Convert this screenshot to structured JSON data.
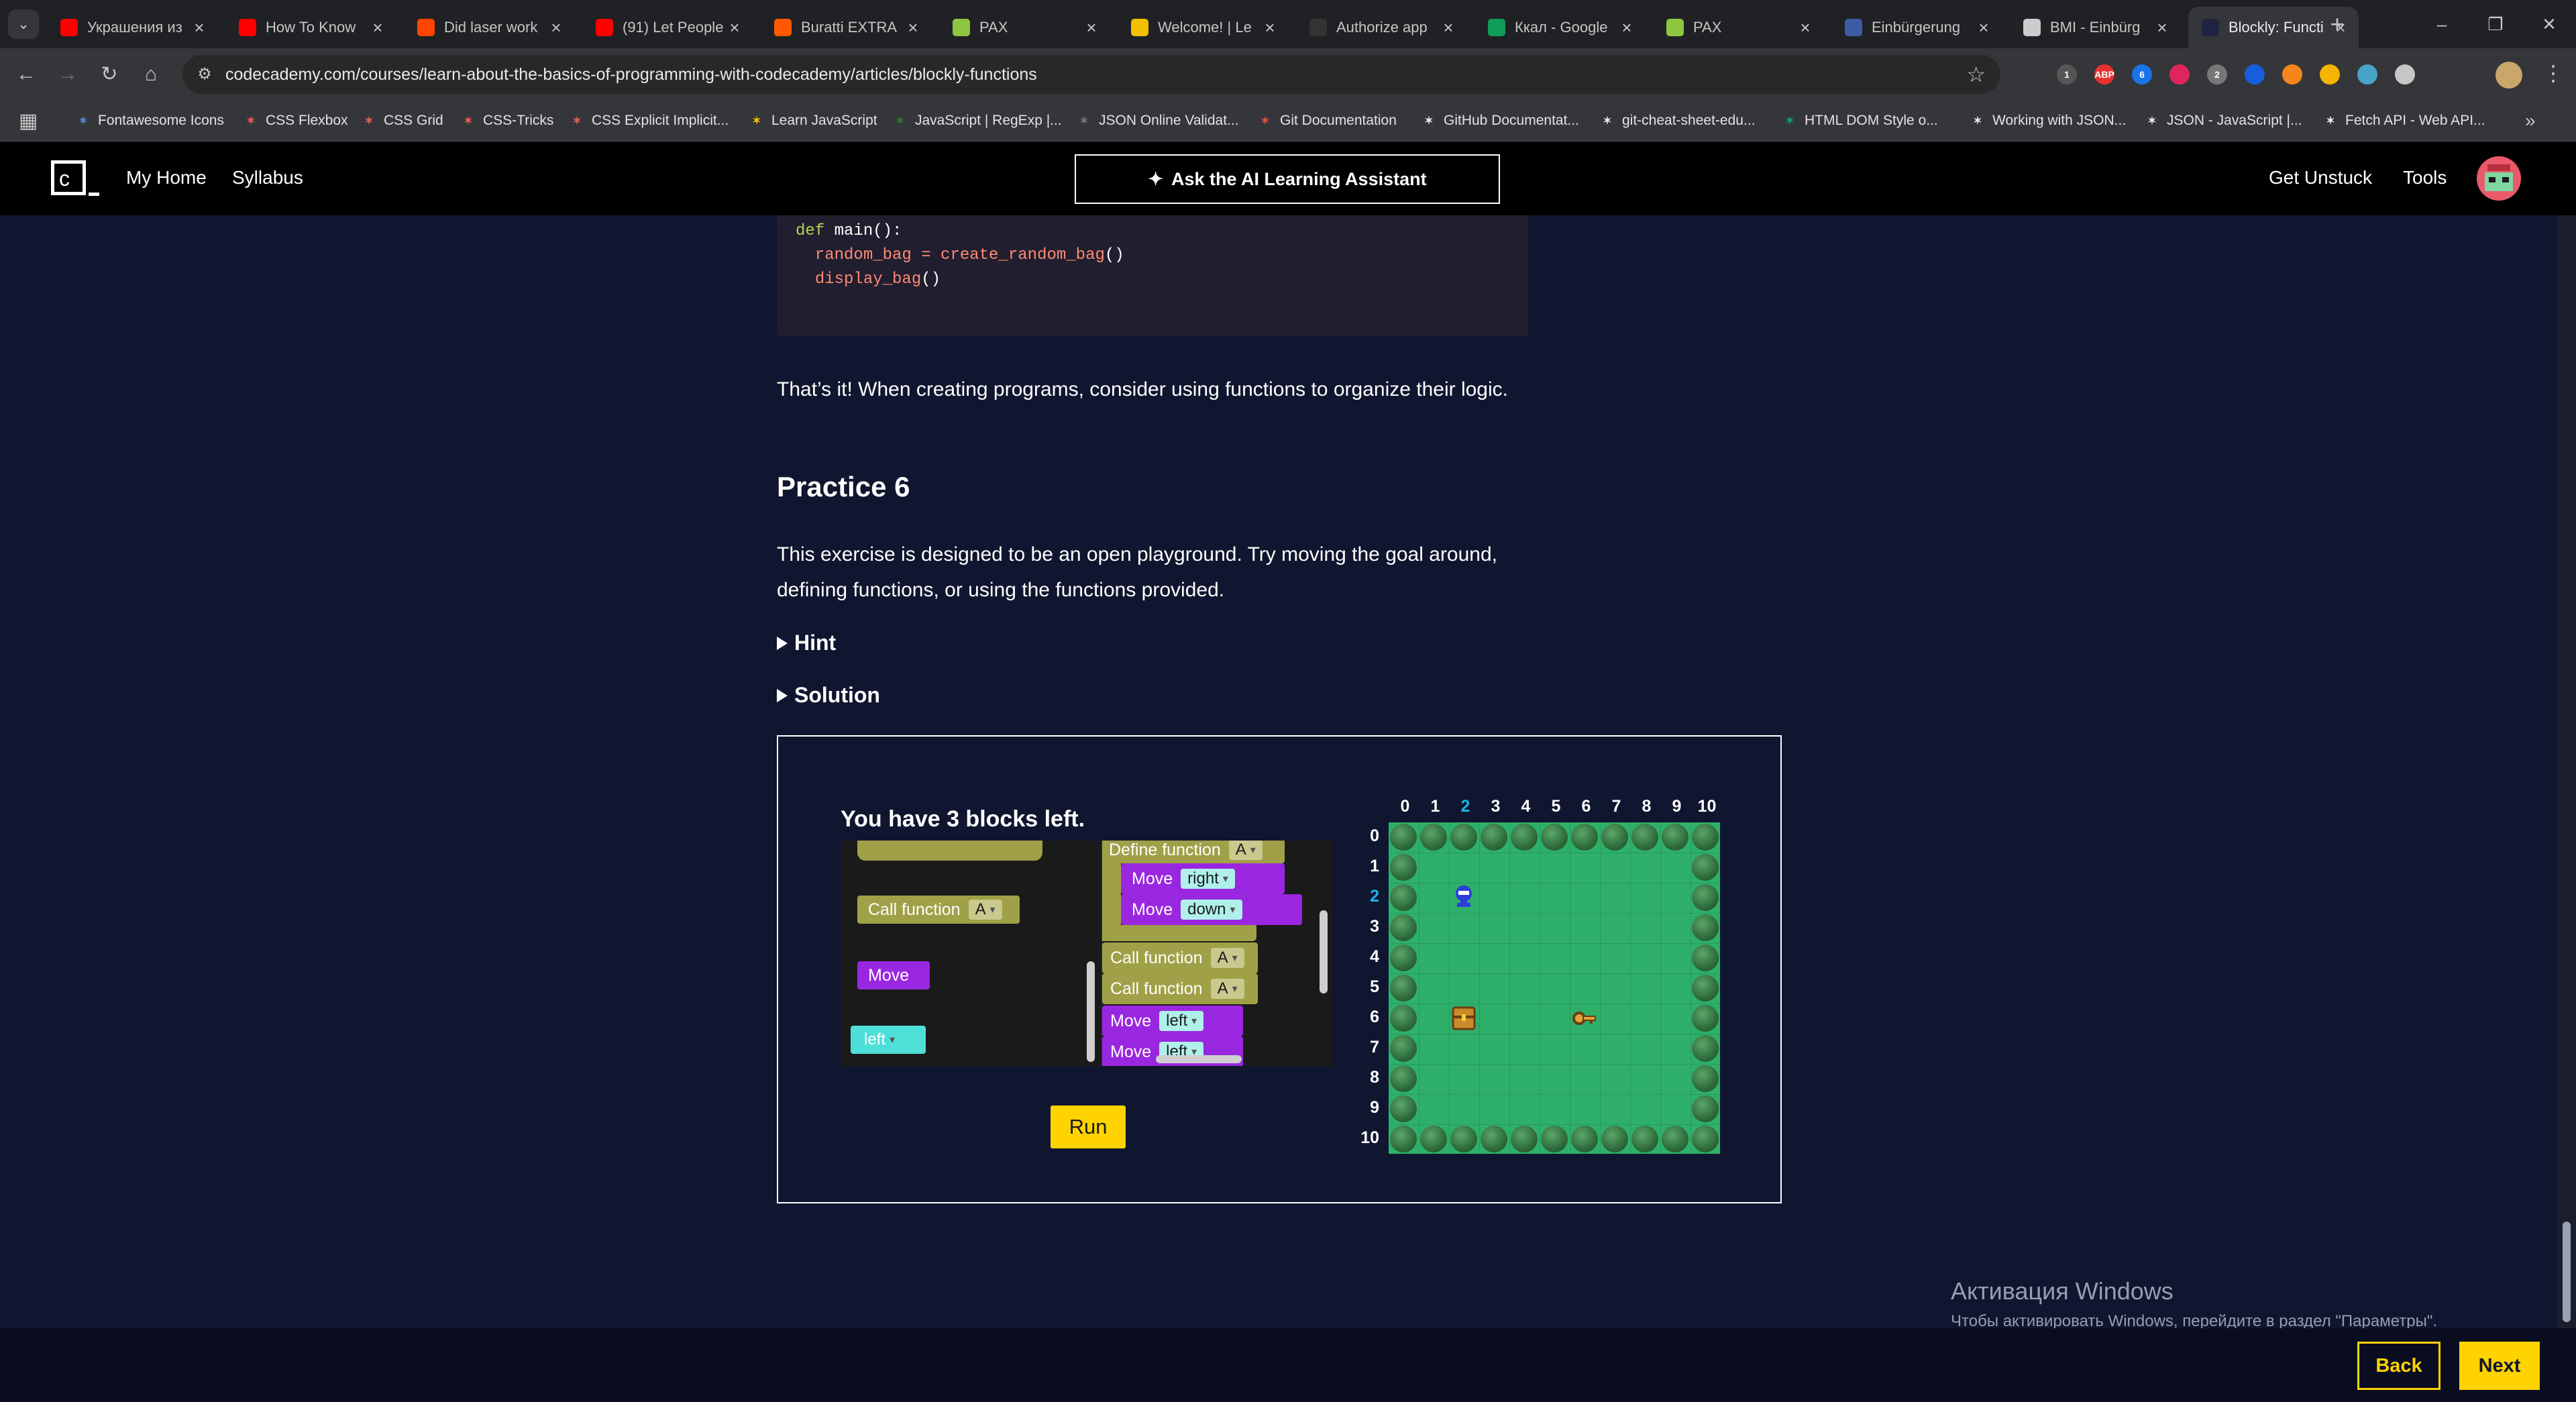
{
  "browser": {
    "tabs": [
      {
        "title": "Украшения из",
        "icon": "youtube-icon",
        "color": "#ff0000"
      },
      {
        "title": "How To Know",
        "icon": "youtube-icon",
        "color": "#ff0000"
      },
      {
        "title": "Did laser work",
        "icon": "reddit-icon",
        "color": "#ff4500"
      },
      {
        "title": "(91) Let People",
        "icon": "youtube-icon",
        "color": "#ff0000"
      },
      {
        "title": "Buratti EXTRA",
        "icon": "flame-icon",
        "color": "#ff5a00"
      },
      {
        "title": "PAX",
        "icon": "pax-icon",
        "color": "#8ec63f"
      },
      {
        "title": "Welcome! | Le",
        "icon": "js-icon",
        "color": "#f0c000"
      },
      {
        "title": "Authorize app",
        "icon": "github-icon",
        "color": "#333333"
      },
      {
        "title": "Ккал - Google",
        "icon": "sheets-icon",
        "color": "#0f9d58"
      },
      {
        "title": "PAX",
        "icon": "pax-icon",
        "color": "#8ec63f"
      },
      {
        "title": "Einbürgerung",
        "icon": "page-icon",
        "color": "#3b5ba5"
      },
      {
        "title": "BMI - Einbürg",
        "icon": "bmi-icon",
        "color": "#cccccc"
      },
      {
        "title": "Blockly: Functi",
        "icon": "codecademy-icon",
        "color": "#1f2540",
        "active": true
      }
    ],
    "url": "codecademy.com/courses/learn-about-the-basics-of-programming-with-codecademy/articles/blockly-functions",
    "extensions": [
      {
        "name": "extension-1-icon",
        "color": "#555555",
        "badge": "1"
      },
      {
        "name": "adblock-icon",
        "color": "#e83030",
        "label": "ABP"
      },
      {
        "name": "extension-6-icon",
        "color": "#1a73e8",
        "badge": "6"
      },
      {
        "name": "extension-pink-icon",
        "color": "#e0245e"
      },
      {
        "name": "extension-2-icon",
        "color": "#777777",
        "badge": "2"
      },
      {
        "name": "bitwarden-icon",
        "color": "#175ddc"
      },
      {
        "name": "metamask-icon",
        "color": "#f6851b"
      },
      {
        "name": "extension-yellow-icon",
        "color": "#f4b400"
      },
      {
        "name": "extension-cyan-icon",
        "color": "#4aa3c8"
      },
      {
        "name": "puzzle-icon",
        "color": "#c4c7c5"
      }
    ],
    "bookmarks": [
      {
        "label": "Fontawesome Icons",
        "icon": "flag-icon",
        "color": "#538dd7"
      },
      {
        "label": "CSS Flexbox",
        "icon": "css-tricks-icon",
        "color": "#e8634f"
      },
      {
        "label": "CSS Grid",
        "icon": "css-tricks-icon",
        "color": "#e8634f"
      },
      {
        "label": "CSS-Tricks",
        "icon": "css-tricks-icon",
        "color": "#e8634f"
      },
      {
        "label": "CSS Explicit Implicit...",
        "icon": "css-tricks-icon",
        "color": "#e8634f"
      },
      {
        "label": "Learn JavaScript",
        "icon": "js-icon",
        "color": "#f0c000"
      },
      {
        "label": "JavaScript | RegExp |...",
        "icon": "w3-icon",
        "color": "#2e7d32"
      },
      {
        "label": "JSON Online Validat...",
        "icon": "json-icon",
        "color": "#777777"
      },
      {
        "label": "Git Documentation",
        "icon": "git-icon",
        "color": "#f05032"
      },
      {
        "label": "GitHub Documentat...",
        "icon": "github-icon",
        "color": "#e8eaed"
      },
      {
        "label": "git-cheat-sheet-edu...",
        "icon": "github-icon",
        "color": "#e8eaed"
      },
      {
        "label": "HTML DOM Style o...",
        "icon": "w3-icon",
        "color": "#04aa6d"
      },
      {
        "label": "Working with JSON...",
        "icon": "mdn-icon",
        "color": "#e8eaed"
      },
      {
        "label": "JSON - JavaScript |...",
        "icon": "mdn-icon",
        "color": "#e8eaed"
      },
      {
        "label": "Fetch API - Web API...",
        "icon": "mdn-icon",
        "color": "#e8eaed"
      }
    ]
  },
  "header": {
    "nav": [
      "My Home",
      "Syllabus"
    ],
    "ai_button": "Ask the AI Learning Assistant",
    "right_nav": [
      "Get Unstuck",
      "Tools"
    ]
  },
  "article": {
    "code_lines": [
      {
        "a": "def ",
        "b": "main",
        "c": "():"
      },
      {
        "a": "  random_bag = ",
        "b": "create_random_bag",
        "c": "()"
      },
      {
        "a": "  ",
        "b": "display_bag",
        "c": "()"
      }
    ],
    "conclusion": "That’s it! When creating programs, consider using functions to organize their logic.",
    "practice_heading": "Practice 6",
    "practice_text": "This exercise is designed to be an open playground. Try moving the goal around, defining functions, or using the functions provided.",
    "hint_label": "Hint",
    "solution_label": "Solution"
  },
  "blockly": {
    "blocks_left": "You have 3 blocks left.",
    "toolbox": {
      "call_label": "Call function",
      "call_value": "A",
      "move_label": "Move",
      "dir_value": "left"
    },
    "workspace": {
      "define_label": "Define function",
      "define_value": "A",
      "inner_moves": [
        {
          "label": "Move",
          "value": "right"
        },
        {
          "label": "Move",
          "value": "down"
        }
      ],
      "calls": [
        {
          "label": "Call function",
          "value": "A"
        },
        {
          "label": "Call function",
          "value": "A"
        }
      ],
      "tail_moves": [
        {
          "label": "Move",
          "value": "left"
        },
        {
          "label": "Move",
          "value": "left"
        }
      ]
    },
    "run_label": "Run",
    "maze": {
      "col_labels": [
        "0",
        "1",
        "2",
        "3",
        "4",
        "5",
        "6",
        "7",
        "8",
        "9",
        "10"
      ],
      "row_labels": [
        "0",
        "1",
        "2",
        "3",
        "4",
        "5",
        "6",
        "7",
        "8",
        "9",
        "10"
      ],
      "highlight": "2",
      "player": {
        "col": 2,
        "row": 2
      },
      "chest": {
        "col": 2,
        "row": 6
      },
      "key": {
        "col": 6,
        "row": 6
      }
    }
  },
  "windows_activation": {
    "title": "Активация Windows",
    "subtitle": "Чтобы активировать Windows, перейдите в раздел \"Параметры\"."
  },
  "footer": {
    "back": "Back",
    "next": "Next"
  }
}
